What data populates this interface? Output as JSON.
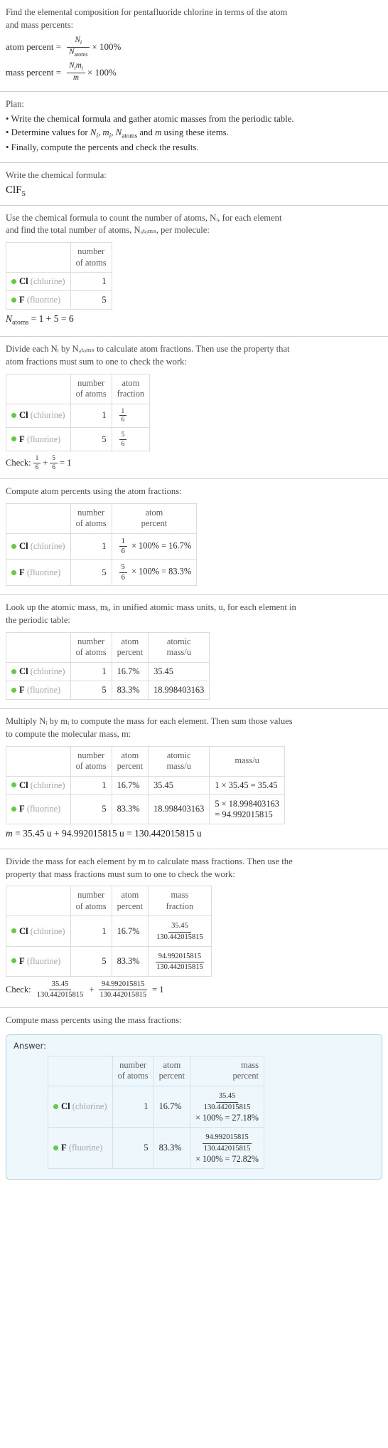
{
  "problem": {
    "prompt_line1": "Find the elemental composition for pentafluoride chlorine in terms of the atom",
    "prompt_line2": "and mass percents:",
    "atom_percent_label": "atom percent =",
    "mass_percent_label": "mass percent =",
    "times_100": "× 100%"
  },
  "plan": {
    "heading": "Plan:",
    "items": [
      "• Write the chemical formula and gather atomic masses from the periodic table.",
      "• Determine values for Nᵢ, mᵢ, Nₐₜₒₘₛ and m using these items.",
      "• Finally, compute the percents and check the results."
    ],
    "item2_prefix": "• Determine values for ",
    "item2_suffix": " using these items."
  },
  "formula_section": {
    "instruction": "Write the chemical formula:",
    "formula_base": "ClF",
    "formula_sub": "5"
  },
  "count_section": {
    "instruction_line1": "Use the chemical formula to count the number of atoms, Nᵢ, for each element",
    "instruction_line2": "and find the total number of atoms, Nₐₜₒₘₛ, per molecule:",
    "headers": [
      "",
      "number of atoms"
    ],
    "rows": [
      {
        "symbol": "Cl",
        "name": "(chlorine)",
        "color": "#61cc3e",
        "atoms": "1"
      },
      {
        "symbol": "F",
        "name": "(fluorine)",
        "color": "#61cc3e",
        "atoms": "5"
      }
    ],
    "total_expression": "= 1 + 5 = 6"
  },
  "fraction_section": {
    "instruction_line1": "Divide each Nᵢ by Nₐₜₒₘₛ to calculate atom fractions. Then use the property that",
    "instruction_line2": "atom fractions must sum to one to check the work:",
    "headers": [
      "",
      "number of atoms",
      "atom fraction"
    ],
    "rows": [
      {
        "symbol": "Cl",
        "name": "(chlorine)",
        "atoms": "1",
        "frac_num": "1",
        "frac_den": "6"
      },
      {
        "symbol": "F",
        "name": "(fluorine)",
        "atoms": "5",
        "frac_num": "5",
        "frac_den": "6"
      }
    ],
    "check_label": "Check:",
    "check_plus": "+",
    "check_equals": "= 1"
  },
  "percent_section": {
    "instruction": "Compute atom percents using the atom fractions:",
    "headers": [
      "",
      "number of atoms",
      "atom percent"
    ],
    "rows": [
      {
        "symbol": "Cl",
        "name": "(chlorine)",
        "atoms": "1",
        "frac_num": "1",
        "frac_den": "6",
        "expr": "× 100% = 16.7%"
      },
      {
        "symbol": "F",
        "name": "(fluorine)",
        "atoms": "5",
        "frac_num": "5",
        "frac_den": "6",
        "expr": "× 100% = 83.3%"
      }
    ]
  },
  "mass_lookup_section": {
    "instruction_line1": "Look up the atomic mass, mᵢ, in unified atomic mass units, u, for each element in",
    "instruction_line2": "the periodic table:",
    "headers": [
      "",
      "number of atoms",
      "atom percent",
      "atomic mass/u"
    ],
    "rows": [
      {
        "symbol": "Cl",
        "name": "(chlorine)",
        "atoms": "1",
        "percent": "16.7%",
        "atomic_mass": "35.45"
      },
      {
        "symbol": "F",
        "name": "(fluorine)",
        "atoms": "5",
        "percent": "83.3%",
        "atomic_mass": "18.998403163"
      }
    ]
  },
  "molecular_mass_section": {
    "instruction_line1": "Multiply Nᵢ by mᵢ to compute the mass for each element. Then sum those values",
    "instruction_line2": "to compute the molecular mass, m:",
    "headers": [
      "",
      "number of atoms",
      "atom percent",
      "atomic mass/u",
      "mass/u"
    ],
    "rows": [
      {
        "symbol": "Cl",
        "name": "(chlorine)",
        "atoms": "1",
        "percent": "16.7%",
        "atomic_mass": "35.45",
        "mass_line1": "1 × 35.45 = 35.45",
        "mass_line2": ""
      },
      {
        "symbol": "F",
        "name": "(fluorine)",
        "atoms": "5",
        "percent": "83.3%",
        "atomic_mass": "18.998403163",
        "mass_line1": "5 × 18.998403163",
        "mass_line2": "= 94.992015815"
      }
    ],
    "total_expression": "= 35.45 u + 94.992015815 u = 130.442015815 u"
  },
  "mass_fraction_section": {
    "instruction_line1": "Divide the mass for each element by m to calculate mass fractions. Then use the",
    "instruction_line2": "property that mass fractions must sum to one to check the work:",
    "headers": [
      "",
      "number of atoms",
      "atom percent",
      "mass fraction"
    ],
    "rows": [
      {
        "symbol": "Cl",
        "name": "(chlorine)",
        "atoms": "1",
        "percent": "16.7%",
        "frac_num": "35.45",
        "frac_den": "130.442015815"
      },
      {
        "symbol": "F",
        "name": "(fluorine)",
        "atoms": "5",
        "percent": "83.3%",
        "frac_num": "94.992015815",
        "frac_den": "130.442015815"
      }
    ],
    "check_label": "Check:",
    "check_plus": "+",
    "check_equals": "= 1"
  },
  "answer_section": {
    "instruction": "Compute mass percents using the mass fractions:",
    "answer_label": "Answer:",
    "headers": [
      "",
      "number of atoms",
      "atom percent",
      "mass percent"
    ],
    "rows": [
      {
        "symbol": "Cl",
        "name": "(chlorine)",
        "atoms": "1",
        "percent": "16.7%",
        "frac_num": "35.45",
        "frac_den": "130.442015815",
        "result": "× 100% = 27.18%"
      },
      {
        "symbol": "F",
        "name": "(fluorine)",
        "atoms": "5",
        "percent": "83.3%",
        "frac_num": "94.992015815",
        "frac_den": "130.442015815",
        "result": "× 100% = 72.82%"
      }
    ],
    "accent_color": "#a9d5e4",
    "background_color": "#eef7fb"
  },
  "labels": {
    "col_number": "number",
    "col_of_atoms": "of atoms",
    "col_atom": "atom",
    "col_fraction": "fraction",
    "col_percent": "percent",
    "col_atomic": "atomic",
    "col_mass_u": "mass/u",
    "col_mass": "mass",
    "col_massu_header": "mass/u"
  }
}
